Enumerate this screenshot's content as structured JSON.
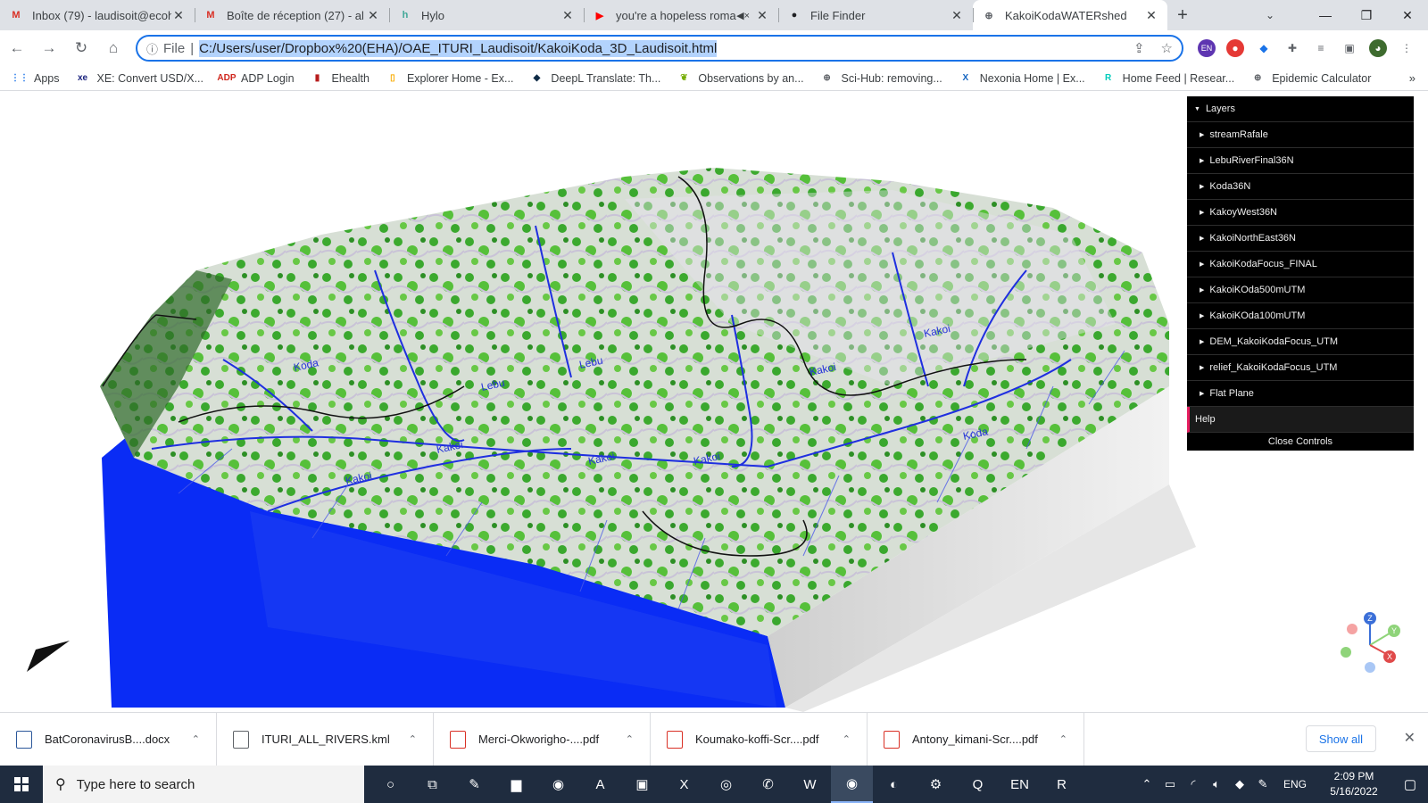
{
  "tabs": [
    {
      "label": "Inbox (79) - laudisoit@ecoh",
      "icon": "gmail-icon",
      "icon_text": "M",
      "color": "#d93025"
    },
    {
      "label": "Boîte de réception (27) - al",
      "icon": "gmail-icon",
      "icon_text": "M",
      "color": "#d93025"
    },
    {
      "label": "Hylo",
      "icon": "hylo-icon",
      "icon_text": "h",
      "color": "#40a798"
    },
    {
      "label": "you're a hopeless roma",
      "icon": "youtube-icon",
      "icon_text": "▶",
      "color": "#ff0000",
      "muted": true
    },
    {
      "label": "File Finder",
      "icon": "github-icon",
      "icon_text": "●",
      "color": "#202124"
    },
    {
      "label": "KakoiKodaWATERshed",
      "icon": "globe-icon",
      "icon_text": "⊕",
      "color": "#5f6368",
      "active": true
    }
  ],
  "address": {
    "protocol": "File",
    "url": "C:/Users/user/Dropbox%20(EHA)/OAE_ITURI_Laudisoit/KakoiKoda_3D_Laudisoit.html"
  },
  "bookmarks": [
    {
      "label": "Apps",
      "icon": "apps-grid-icon",
      "icon_text": "⋮⋮",
      "color": "#1a73e8"
    },
    {
      "label": "XE: Convert USD/X...",
      "icon": "xe-icon",
      "icon_text": "xe",
      "color": "#1a237e"
    },
    {
      "label": "ADP Login",
      "icon": "adp-icon",
      "icon_text": "ADP",
      "color": "#d0271d"
    },
    {
      "label": "Ehealth",
      "icon": "ehealth-icon",
      "icon_text": "▮",
      "color": "#b71c1c"
    },
    {
      "label": "Explorer Home - Ex...",
      "icon": "explorer-icon",
      "icon_text": "▯",
      "color": "#f9ab00"
    },
    {
      "label": "DeepL Translate: Th...",
      "icon": "deepl-icon",
      "icon_text": "◆",
      "color": "#0f2b46"
    },
    {
      "label": "Observations by an...",
      "icon": "inaturalist-icon",
      "icon_text": "❦",
      "color": "#74ac00"
    },
    {
      "label": "Sci-Hub: removing...",
      "icon": "scihub-icon",
      "icon_text": "⊕",
      "color": "#5f6368"
    },
    {
      "label": "Nexonia Home | Ex...",
      "icon": "nexonia-icon",
      "icon_text": "X",
      "color": "#1565c0"
    },
    {
      "label": "Home Feed | Resear...",
      "icon": "researchgate-icon",
      "icon_text": "R",
      "color": "#00ccbb"
    },
    {
      "label": "Epidemic Calculator",
      "icon": "globe-icon",
      "icon_text": "⊕",
      "color": "#5f6368"
    }
  ],
  "bookmarks_more": "»",
  "layers_panel": {
    "title": "Layers",
    "items": [
      "streamRafale",
      "LebuRiverFinal36N",
      "Koda36N",
      "KakoyWest36N",
      "KakoiNorthEast36N",
      "KakoiKodaFocus_FINAL",
      "KakoiKOda500mUTM",
      "KakoiKOda100mUTM",
      "DEM_KakoiKodaFocus_UTM",
      "relief_KakoiKodaFocus_UTM",
      "Flat Plane"
    ],
    "help": "Help",
    "close": "Close Controls"
  },
  "map_labels": [
    "Koda",
    "Lebu",
    "Lebu",
    "Kakoi",
    "Kakoi",
    "Kakoi",
    "Kakoi",
    "Kakoi",
    "Kakoi",
    "Koda"
  ],
  "axes": {
    "z": "Z",
    "y": "Y",
    "x": "X"
  },
  "downloads": [
    {
      "name": "BatCoronavirusB....docx",
      "icon": "word-doc-icon",
      "color": "#2b579a"
    },
    {
      "name": "ITURI_ALL_RIVERS.kml",
      "icon": "kml-file-icon",
      "color": "#5f6368"
    },
    {
      "name": "Merci-Okworigho-....pdf",
      "icon": "pdf-file-icon",
      "color": "#d93025"
    },
    {
      "name": "Koumako-koffi-Scr....pdf",
      "icon": "pdf-file-icon",
      "color": "#d93025"
    },
    {
      "name": "Antony_kimani-Scr....pdf",
      "icon": "pdf-file-icon",
      "color": "#d93025"
    }
  ],
  "show_all": "Show all",
  "taskbar": {
    "search_placeholder": "Type here to search",
    "apps": [
      {
        "icon": "cortana-icon",
        "glyph": "○"
      },
      {
        "icon": "task-view-icon",
        "glyph": "⧉"
      },
      {
        "icon": "notepad-icon",
        "glyph": "✎"
      },
      {
        "icon": "file-explorer-icon",
        "glyph": "▆"
      },
      {
        "icon": "chrome-icon",
        "glyph": "◉"
      },
      {
        "icon": "acrobat-icon",
        "glyph": "A"
      },
      {
        "icon": "photos-icon",
        "glyph": "▣"
      },
      {
        "icon": "excel-icon",
        "glyph": "X"
      },
      {
        "icon": "app-icon",
        "glyph": "◎"
      },
      {
        "icon": "whatsapp-icon",
        "glyph": "✆"
      },
      {
        "icon": "word-icon",
        "glyph": "W"
      },
      {
        "icon": "chrome-active-icon",
        "glyph": "◉",
        "active": true
      },
      {
        "icon": "globe-app-icon",
        "glyph": "◐"
      },
      {
        "icon": "settings-icon",
        "glyph": "⚙"
      },
      {
        "icon": "qgis-icon",
        "glyph": "Q"
      },
      {
        "icon": "keyboard-en-icon",
        "glyph": "EN"
      },
      {
        "icon": "r-icon",
        "glyph": "R"
      }
    ],
    "lang": "ENG",
    "time": "2:09 PM",
    "date": "5/16/2022"
  }
}
